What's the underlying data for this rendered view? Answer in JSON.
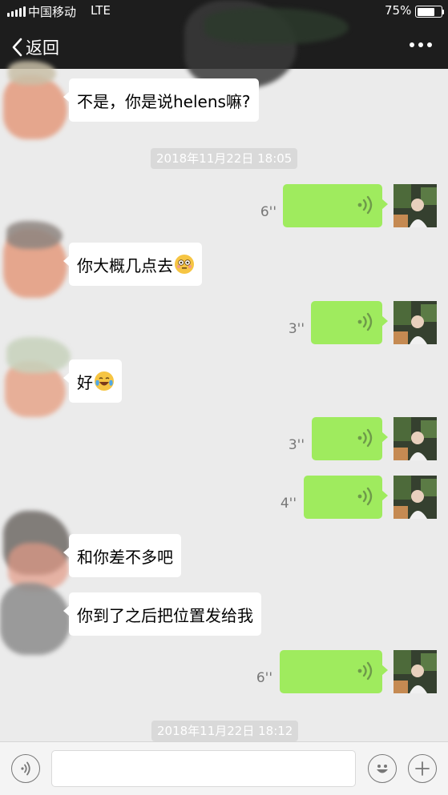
{
  "status_bar": {
    "carrier": "中国移动",
    "network": "LTE",
    "battery_percent": "75%",
    "battery_level": 0.75,
    "signal_bars": 5
  },
  "nav": {
    "back_label": "返回",
    "more_icon": "more-dots-icon"
  },
  "messages": [
    {
      "side": "left",
      "kind": "text",
      "text": "不是，你是说helens嘛?"
    },
    {
      "kind": "timestamp",
      "text": "2018年11月22日 18:05"
    },
    {
      "side": "right",
      "kind": "voice",
      "duration": "6''"
    },
    {
      "side": "left",
      "kind": "text",
      "text": "你大概几点去",
      "emoji": "flushed-face-emoji"
    },
    {
      "side": "right",
      "kind": "voice",
      "duration": "3''"
    },
    {
      "side": "left",
      "kind": "text",
      "text": "好",
      "emoji": "laughing-tears-emoji"
    },
    {
      "side": "right",
      "kind": "voice",
      "duration": "3''"
    },
    {
      "side": "right",
      "kind": "voice",
      "duration": "4''"
    },
    {
      "side": "left",
      "kind": "text",
      "text": "和你差不多吧"
    },
    {
      "side": "left",
      "kind": "text",
      "text": "你到了之后把位置发给我"
    },
    {
      "side": "right",
      "kind": "voice",
      "duration": "6''"
    },
    {
      "kind": "timestamp",
      "text": "2018年11月22日 18:12"
    }
  ],
  "input_bar": {
    "voice_icon": "voice-mode-icon",
    "text_value": "",
    "emoji_icon": "emoji-icon",
    "plus_icon": "plus-icon"
  },
  "colors": {
    "voice_bubble": "#9feb5e",
    "chat_background": "#ebebeb",
    "nav_background": "#1d1d1d"
  }
}
